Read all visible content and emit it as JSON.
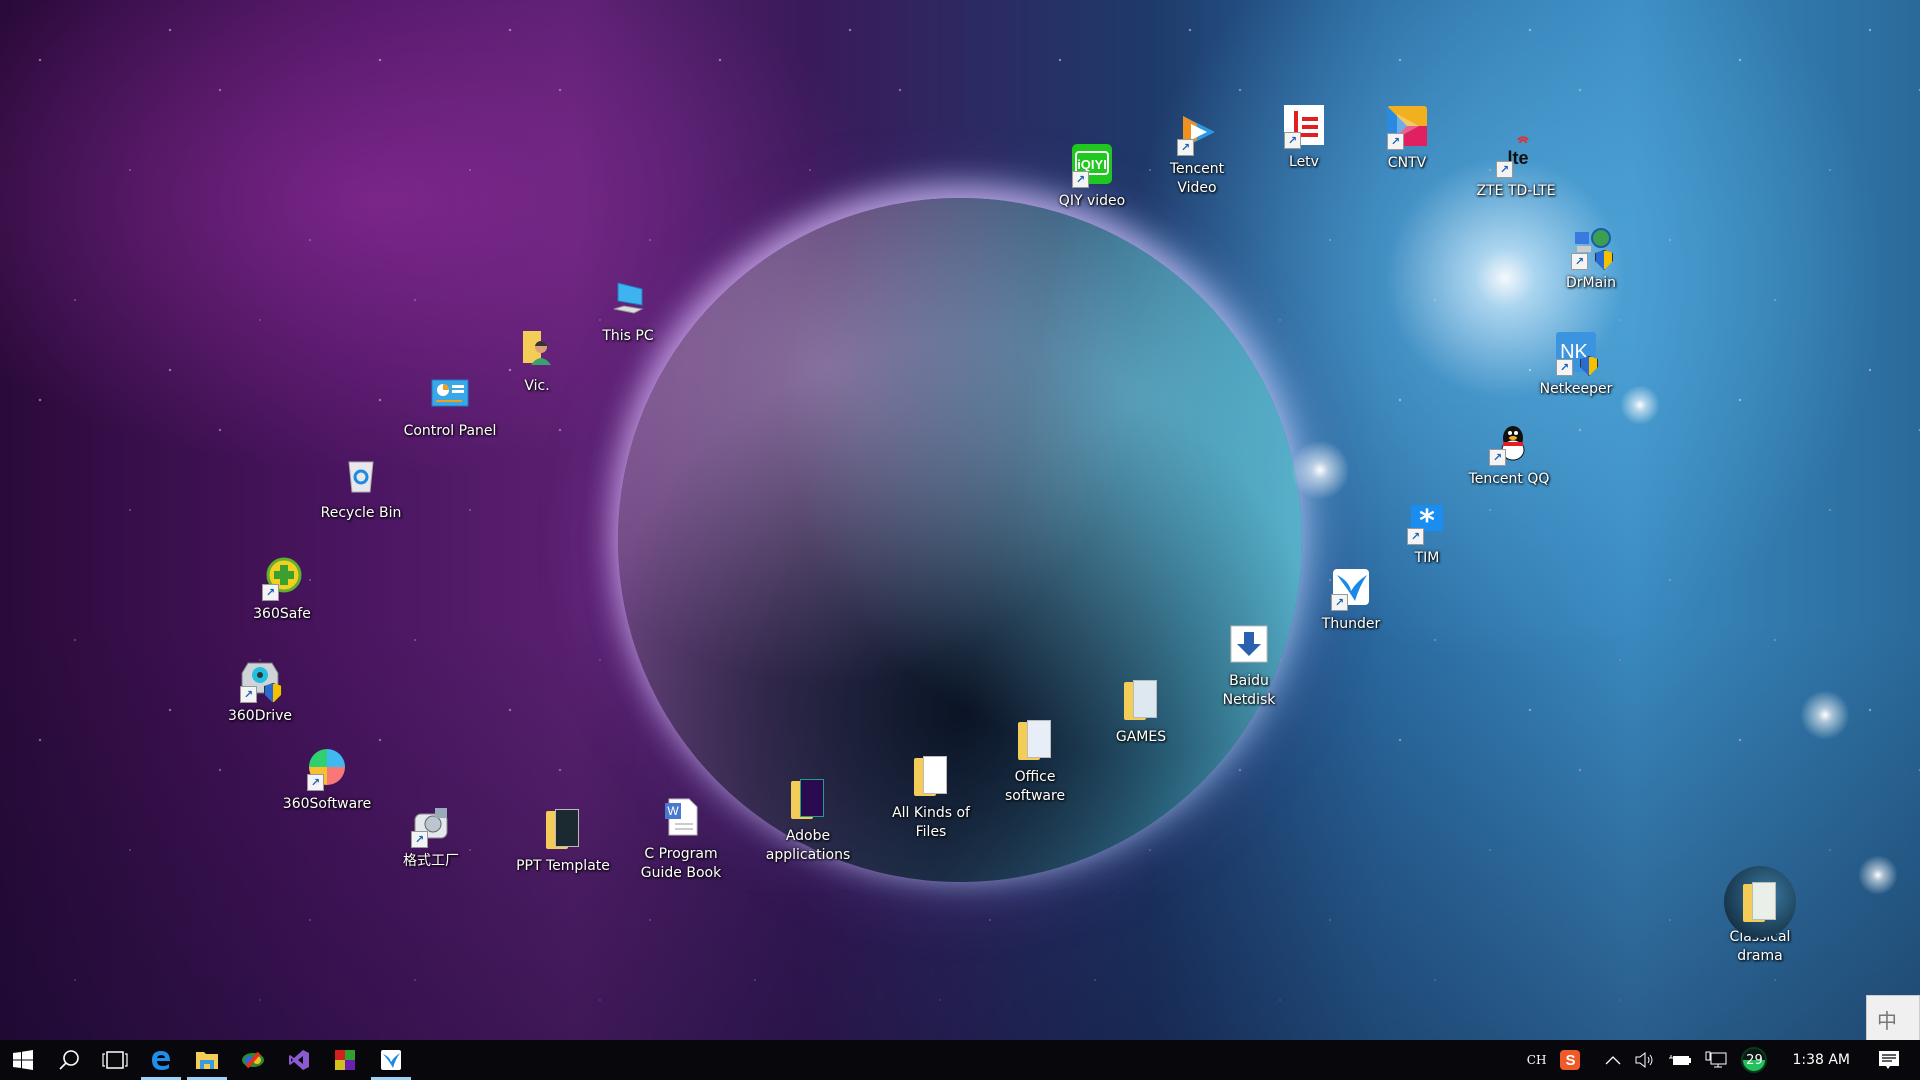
{
  "desktop": {
    "icons": [
      {
        "id": "this-pc",
        "label": "This PC",
        "icon": "computer-icon",
        "shortcut": false
      },
      {
        "id": "vic",
        "label": "Vic.",
        "icon": "user-folder-icon",
        "shortcut": false
      },
      {
        "id": "control-panel",
        "label": "Control Panel",
        "icon": "control-panel-icon",
        "shortcut": false
      },
      {
        "id": "recycle-bin",
        "label": "Recycle Bin",
        "icon": "recycle-bin-icon",
        "shortcut": false
      },
      {
        "id": "360safe",
        "label": "360Safe",
        "icon": "360safe-icon",
        "shortcut": true
      },
      {
        "id": "360drive",
        "label": "360Drive",
        "icon": "360drive-icon",
        "shortcut": true
      },
      {
        "id": "360software",
        "label": "360Software",
        "icon": "360software-icon",
        "shortcut": true
      },
      {
        "id": "format-factory",
        "label": "格式工厂",
        "icon": "format-factory-icon",
        "shortcut": true
      },
      {
        "id": "ppt-template",
        "label": "PPT Template",
        "icon": "folder-icon",
        "shortcut": false
      },
      {
        "id": "c-program-guide",
        "label": "C Program\nGuide Book",
        "icon": "word-document-icon",
        "shortcut": false
      },
      {
        "id": "adobe-apps",
        "label": "Adobe\napplications",
        "icon": "folder-icon",
        "shortcut": false
      },
      {
        "id": "all-kinds-files",
        "label": "All Kinds of\nFiles",
        "icon": "folder-icon",
        "shortcut": false
      },
      {
        "id": "office-software",
        "label": "Office\nsoftware",
        "icon": "folder-icon",
        "shortcut": false
      },
      {
        "id": "games",
        "label": "GAMES",
        "icon": "folder-icon",
        "shortcut": false
      },
      {
        "id": "baidu-netdisk",
        "label": "Baidu\nNetdisk",
        "icon": "download-arrow-icon",
        "shortcut": false
      },
      {
        "id": "thunder",
        "label": "Thunder",
        "icon": "thunder-bird-icon",
        "shortcut": true
      },
      {
        "id": "tim",
        "label": "TIM",
        "icon": "tim-icon",
        "shortcut": true
      },
      {
        "id": "tencent-qq",
        "label": "Tencent QQ",
        "icon": "qq-penguin-icon",
        "shortcut": true
      },
      {
        "id": "netkeeper",
        "label": "Netkeeper",
        "icon": "netkeeper-icon",
        "shortcut": true
      },
      {
        "id": "drmain",
        "label": "DrMain",
        "icon": "network-globe-icon",
        "shortcut": true
      },
      {
        "id": "zte-td-lte",
        "label": "ZTE TD-LTE",
        "icon": "lte-icon",
        "shortcut": true
      },
      {
        "id": "cntv",
        "label": "CNTV",
        "icon": "cntv-icon",
        "shortcut": true
      },
      {
        "id": "letv",
        "label": "Letv",
        "icon": "letv-icon",
        "shortcut": true
      },
      {
        "id": "tencent-video",
        "label": "Tencent\nVideo",
        "icon": "tencent-video-icon",
        "shortcut": true
      },
      {
        "id": "iqiyi",
        "label": "QIY video",
        "icon": "iqiyi-icon",
        "shortcut": true
      },
      {
        "id": "classical-drama",
        "label": "Classical\ndrama",
        "icon": "folder-icon",
        "shortcut": false
      }
    ]
  },
  "taskbar": {
    "apps": [
      {
        "name": "start",
        "icon": "windows-logo-icon",
        "active": false
      },
      {
        "name": "search",
        "icon": "search-icon",
        "active": false
      },
      {
        "name": "task-view",
        "icon": "task-view-icon",
        "active": false
      },
      {
        "name": "edge",
        "icon": "edge-icon",
        "active": true
      },
      {
        "name": "file-explorer",
        "icon": "folder-icon",
        "active": true
      },
      {
        "name": "app-colorful",
        "icon": "colorful-app-icon",
        "active": false
      },
      {
        "name": "visual-studio",
        "icon": "visual-studio-icon",
        "active": false
      },
      {
        "name": "app-squares",
        "icon": "four-squares-icon",
        "active": false
      },
      {
        "name": "thunder",
        "icon": "thunder-bird-icon",
        "active": true
      }
    ],
    "tray": {
      "input_lang": "CH",
      "ime_icon": "sogou-s-icon",
      "battery_badge": "29",
      "clock": "1:38 AM",
      "ime_mode": "中"
    }
  },
  "colors": {
    "taskbar_bg": "#08080c",
    "active_indicator": "#9fd4f5",
    "badge_green": "#22c35e"
  }
}
